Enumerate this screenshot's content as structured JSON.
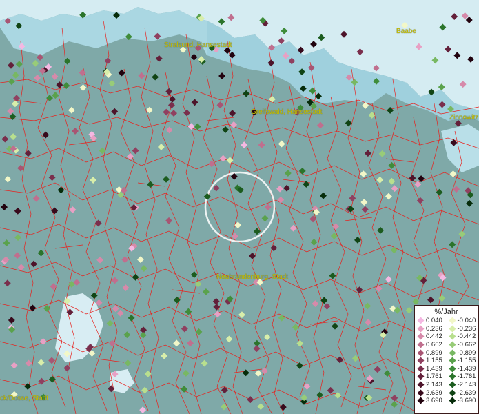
{
  "map": {
    "base_color": "#7fa9a8",
    "land_color": "#7fa9a8",
    "water_color": "#dbeef4",
    "border_color": "#e8201c",
    "selection_circle_color": "#ffffff"
  },
  "places": [
    {
      "id": "stralsund",
      "label": "Stralsund, Hansestadt"
    },
    {
      "id": "greifswald",
      "label": "Greifswald, Hansestadt"
    },
    {
      "id": "neubrandenburg",
      "label": "Neubrandenburg, Stadt"
    },
    {
      "id": "zinnowitz",
      "label": "Zinnowitz"
    },
    {
      "id": "baabe",
      "label": "Baabe"
    },
    {
      "id": "kyritz",
      "label": "ck/Dosse, Stadt"
    }
  ],
  "legend": {
    "title": "%/Jahr",
    "positive": [
      {
        "value": "0.040",
        "color": "#f4b8e2"
      },
      {
        "value": "0.236",
        "color": "#e8a0c4"
      },
      {
        "value": "0.442",
        "color": "#d68aaa"
      },
      {
        "value": "0.662",
        "color": "#c06f8e"
      },
      {
        "value": "0.899",
        "color": "#a85573"
      },
      {
        "value": "1.155",
        "color": "#904060"
      },
      {
        "value": "1.439",
        "color": "#7a2e4c"
      },
      {
        "value": "1.761",
        "color": "#63203a"
      },
      {
        "value": "2.143",
        "color": "#4d142a"
      },
      {
        "value": "2.639",
        "color": "#380a1c"
      },
      {
        "value": "3.690",
        "color": "#22030f"
      }
    ],
    "negative": [
      {
        "value": "-0.040",
        "color": "#f2f7c8"
      },
      {
        "value": "-0.236",
        "color": "#d8eeaa"
      },
      {
        "value": "-0.442",
        "color": "#b8df8e"
      },
      {
        "value": "-0.662",
        "color": "#98cc78"
      },
      {
        "value": "-0.899",
        "color": "#78b862"
      },
      {
        "value": "-1.155",
        "color": "#5aa24c"
      },
      {
        "value": "-1.439",
        "color": "#3f8c3a"
      },
      {
        "value": "-1.761",
        "color": "#2b742b"
      },
      {
        "value": "-2.143",
        "color": "#1c5c1f"
      },
      {
        "value": "-2.639",
        "color": "#104414"
      },
      {
        "value": "-3.690",
        "color": "#062c0a"
      }
    ]
  }
}
